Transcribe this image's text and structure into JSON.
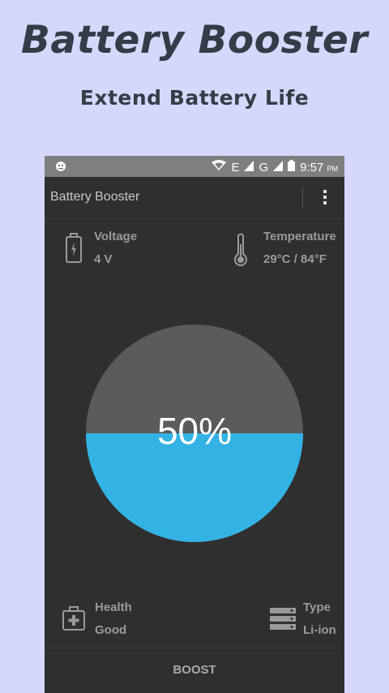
{
  "promo": {
    "title": "Battery Booster",
    "subtitle": "Extend Battery Life"
  },
  "statusbar": {
    "network_label": "E",
    "network_label_2": "G",
    "time": "9:57",
    "ampm": "PM"
  },
  "appbar": {
    "title": "Battery Booster",
    "menu_icon": "more-vert-icon"
  },
  "stats": {
    "voltage": {
      "label": "Voltage",
      "value": "4 V",
      "icon": "battery-icon"
    },
    "temperature": {
      "label": "Temperature",
      "value": "29°C / 84°F",
      "icon": "thermometer-icon"
    },
    "health": {
      "label": "Health",
      "value": "Good",
      "icon": "medical-kit-icon"
    },
    "type": {
      "label": "Type",
      "value": "Li-ion",
      "icon": "stack-icon"
    }
  },
  "gauge": {
    "percent_text": "50%",
    "level": 0.5,
    "fill_color": "#33b3e4",
    "empty_color": "#5b5b5b"
  },
  "bottom": {
    "boost_label": "BOOST"
  },
  "colors": {
    "background": "#d5d8fb",
    "phone_bg": "#2f2f2f",
    "statusbar_bg": "#7f7f7f",
    "promo_text": "#353c48"
  }
}
